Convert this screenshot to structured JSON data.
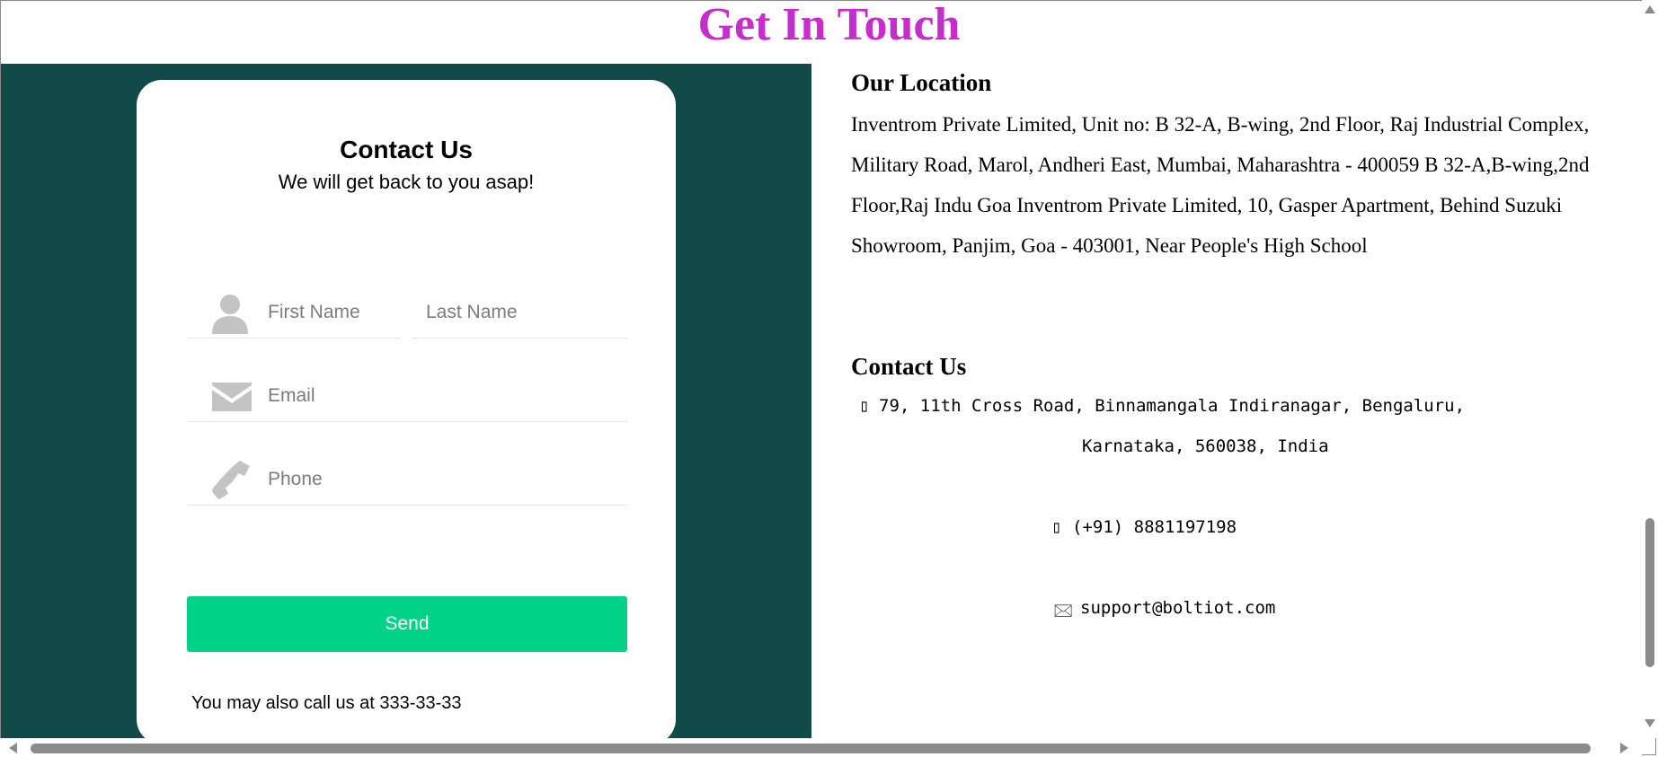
{
  "page": {
    "title": "Get In Touch"
  },
  "form": {
    "title": "Contact Us",
    "subtitle": "We will get back to you asap!",
    "first_name_placeholder": "First Name",
    "last_name_placeholder": "Last Name",
    "email_placeholder": "Email",
    "phone_placeholder": "Phone",
    "send_label": "Send",
    "call_note": "You may also call us at 333-33-33"
  },
  "location": {
    "title": "Our Location",
    "address": "Inventrom Private Limited, Unit no: B 32-A, B-wing, 2nd Floor, Raj Industrial Complex, Military Road, Marol, Andheri East, Mumbai, Maharashtra - 400059 B 32-A,B-wing,2nd Floor,Raj Indu Goa Inventrom Private Limited, 10, Gasper Apartment, Behind Suzuki Showroom, Panjim, Goa - 403001, Near People's High School"
  },
  "contact": {
    "title": "Contact Us",
    "address_line1": "79, 11th Cross Road, Binnamangala Indiranagar, Bengaluru,",
    "address_line2": "Karnataka, 560038, India",
    "phone": "(+91) 8881197198",
    "email": "support@boltiot.com",
    "pin_glyph": "▯",
    "phone_glyph": "▯",
    "mail_glyph": "🖂"
  },
  "colors": {
    "title": "#c62ecb",
    "panel": "#114a48",
    "button": "#00d287"
  },
  "icons": [
    "user-icon",
    "envelope-icon",
    "phone-icon",
    "map-pin-icon",
    "mail-icon"
  ]
}
